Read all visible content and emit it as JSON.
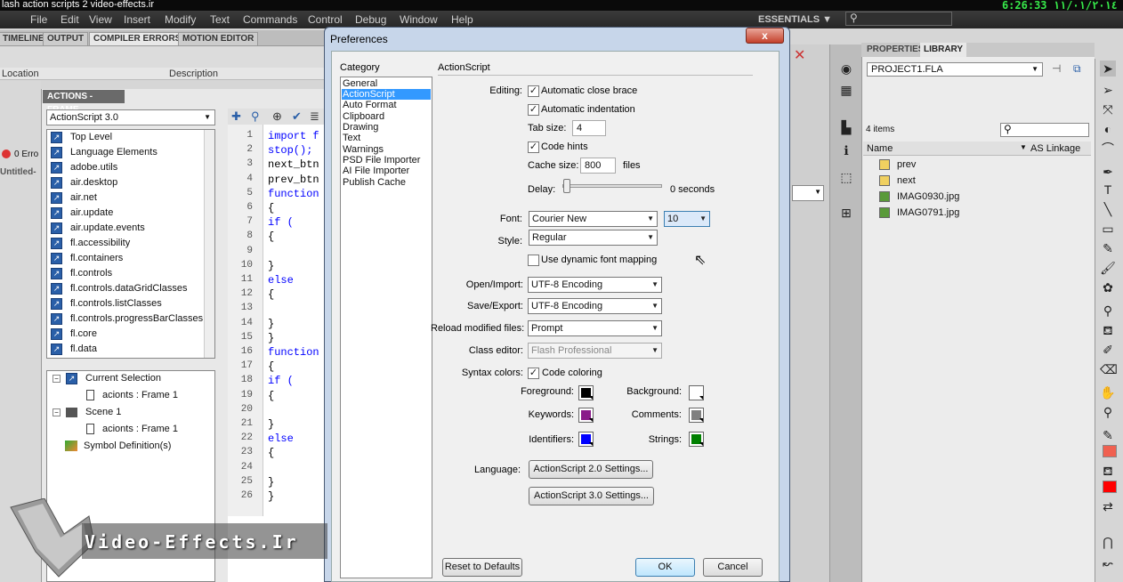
{
  "window": {
    "title": "lash action scripts 2 video-effects.ir",
    "clock": "6:26:33  ١١/٠١/٢٠١٤"
  },
  "menu": [
    "File",
    "Edit",
    "View",
    "Insert",
    "Modify",
    "Text",
    "Commands",
    "Control",
    "Debug",
    "Window",
    "Help"
  ],
  "workspace": "ESSENTIALS ▼",
  "panel_tabs": [
    "TIMELINE",
    "OUTPUT",
    "COMPILER ERRORS",
    "MOTION EDITOR"
  ],
  "compiler": {
    "col_location": "Location",
    "col_description": "Description",
    "errors": "0 Erro",
    "untitled": "Untitled-"
  },
  "actions": {
    "header": "ACTIONS - FRAME",
    "version": "ActionScript 3.0",
    "toolbox": [
      "Top Level",
      "Language Elements",
      "adobe.utils",
      "air.desktop",
      "air.net",
      "air.update",
      "air.update.events",
      "fl.accessibility",
      "fl.containers",
      "fl.controls",
      "fl.controls.dataGridClasses",
      "fl.controls.listClasses",
      "fl.controls.progressBarClasses",
      "fl.core",
      "fl.data"
    ],
    "script_nav": [
      "Current Selection",
      "acionts : Frame 1",
      "Scene 1",
      "acionts : Frame 1",
      "Symbol Definition(s)"
    ]
  },
  "code": {
    "line_numbers": [
      "1",
      "2",
      "3",
      "4",
      "5",
      "6",
      "7",
      "8",
      "9",
      "10",
      "11",
      "12",
      "13",
      "14",
      "15",
      "16",
      "17",
      "18",
      "19",
      "20",
      "21",
      "22",
      "23",
      "24",
      "25",
      "26"
    ],
    "lines": [
      "import f",
      "stop();",
      "next_btn",
      "prev_btn",
      "function",
      "{",
      "   if (",
      "   {",
      "",
      "   }",
      "   else",
      "   {",
      "",
      "   }",
      "}",
      "function",
      "{",
      "   if (",
      "   {",
      "",
      "   }",
      "   else",
      "   {",
      "",
      "   }",
      "}"
    ]
  },
  "dialog": {
    "title": "Preferences",
    "close": "x",
    "category_label": "Category",
    "categories": [
      "General",
      "ActionScript",
      "Auto Format",
      "Clipboard",
      "Drawing",
      "Text",
      "Warnings",
      "PSD File Importer",
      "AI File Importer",
      "Publish Cache"
    ],
    "section": "ActionScript",
    "editing_label": "Editing:",
    "auto_close_brace": "Automatic close brace",
    "auto_indent": "Automatic indentation",
    "tab_size_label": "Tab size:",
    "tab_size": "4",
    "code_hints": "Code hints",
    "cache_size_label": "Cache size:",
    "cache_size": "800",
    "cache_unit": "files",
    "delay_label": "Delay:",
    "delay_value": "0 seconds",
    "delay_level": 0,
    "font_label": "Font:",
    "font": "Courier New",
    "font_size": "10",
    "style_label": "Style:",
    "style": "Regular",
    "dynamic_font": "Use dynamic font mapping",
    "open_import_label": "Open/Import:",
    "open_import": "UTF-8 Encoding",
    "save_export_label": "Save/Export:",
    "save_export": "UTF-8 Encoding",
    "reload_label": "Reload modified files:",
    "reload": "Prompt",
    "class_editor_label": "Class editor:",
    "class_editor": "Flash Professional",
    "syntax_label": "Syntax colors:",
    "code_coloring": "Code coloring",
    "foreground_label": "Foreground:",
    "background_label": "Background:",
    "keywords_label": "Keywords:",
    "comments_label": "Comments:",
    "identifiers_label": "Identifiers:",
    "strings_label": "Strings:",
    "colors": {
      "foreground": "#000000",
      "background": "#ffffff",
      "keywords": "#8a1a8a",
      "comments": "#808080",
      "identifiers": "#0000ff",
      "strings": "#008000"
    },
    "language_label": "Language:",
    "as2_settings": "ActionScript 2.0 Settings...",
    "as3_settings": "ActionScript 3.0 Settings...",
    "reset": "Reset to Defaults",
    "ok": "OK",
    "cancel": "Cancel"
  },
  "library": {
    "tabs": [
      "PROPERTIES",
      "LIBRARY"
    ],
    "document": "PROJECT1.FLA",
    "count": "4 items",
    "col_name": "Name",
    "col_linkage": "AS Linkage",
    "items": [
      "prev",
      "next",
      "IMAG0930.jpg",
      "IMAG0791.jpg"
    ]
  },
  "watermark": "Video-Effects.Ir"
}
